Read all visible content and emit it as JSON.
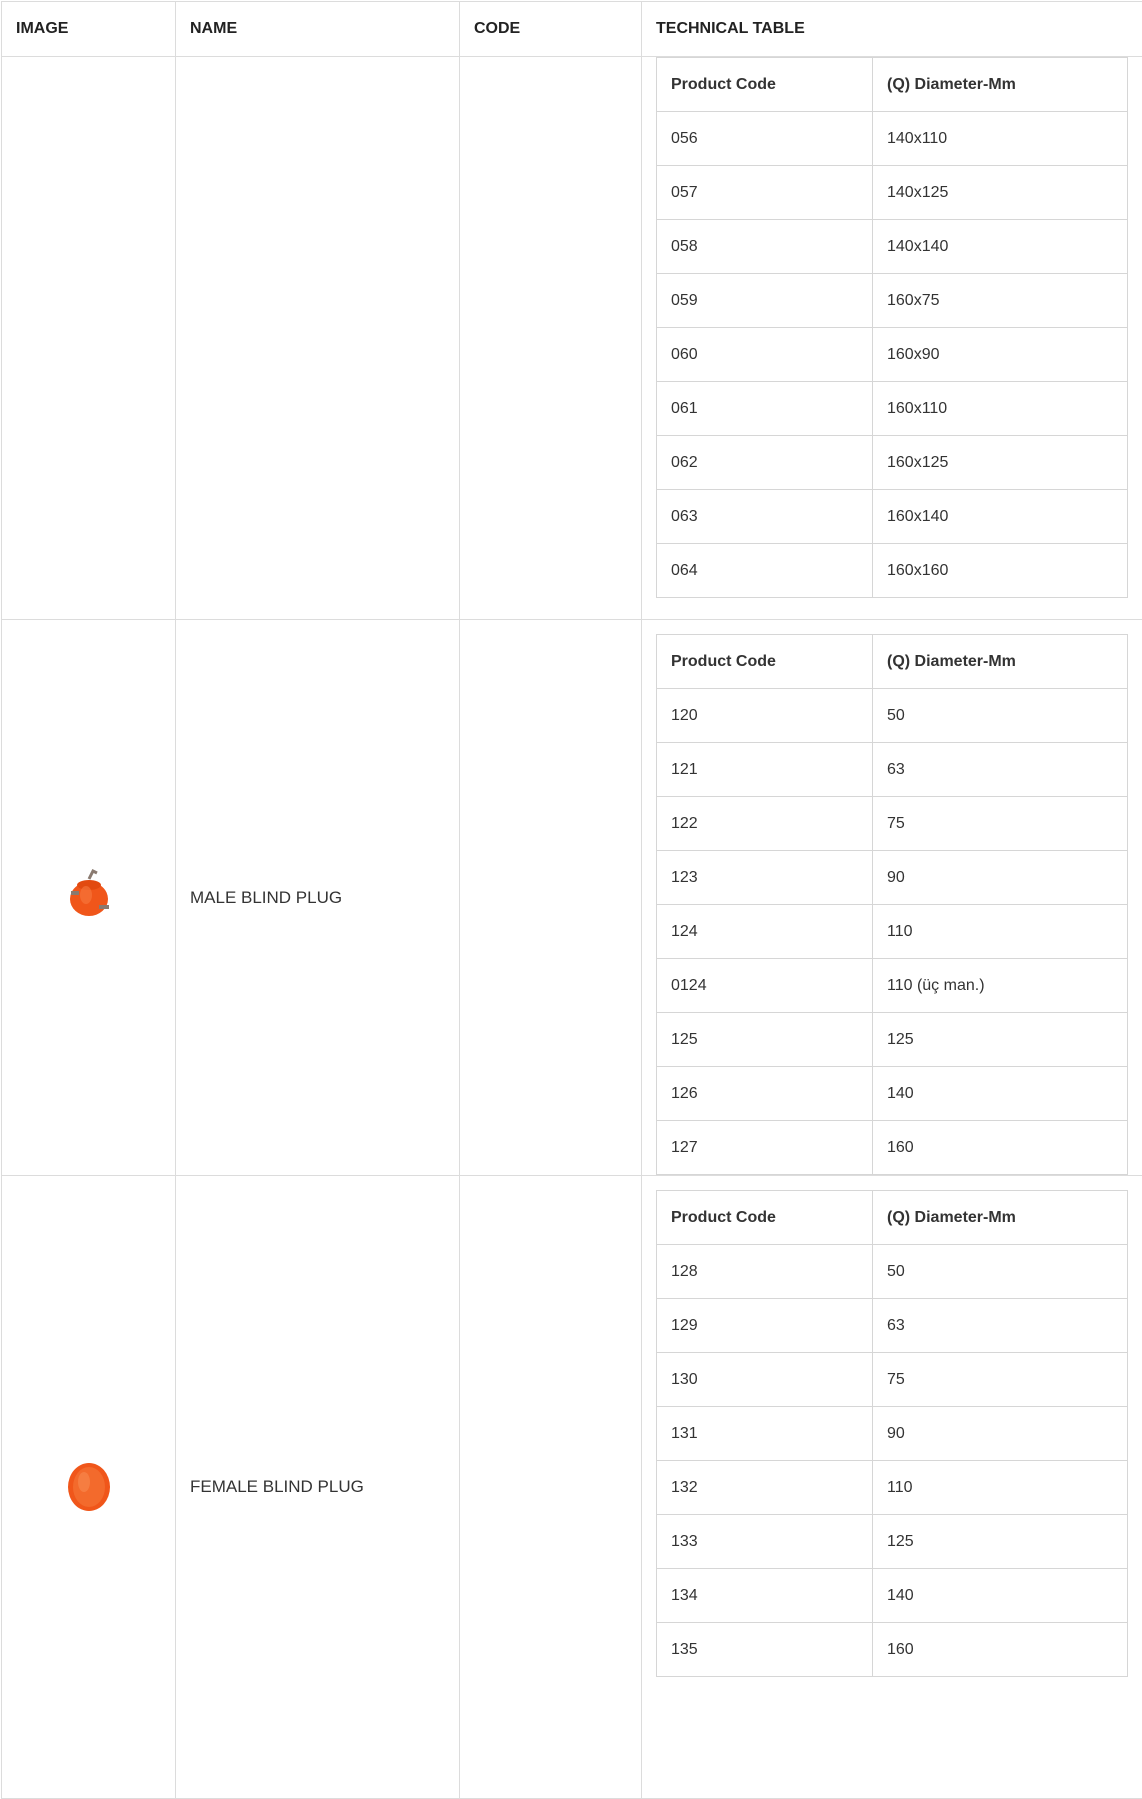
{
  "headers": {
    "image": "IMAGE",
    "name": "NAME",
    "code": "CODE",
    "technical": "TECHNICAL TABLE"
  },
  "inner_headers": {
    "product_code": "Product Code",
    "diameter": "(Q) Diameter-Mm"
  },
  "products": [
    {
      "image": "",
      "name": "",
      "code": "",
      "rows": [
        {
          "code": "056",
          "diameter": "140x110"
        },
        {
          "code": "057",
          "diameter": "140x125"
        },
        {
          "code": "058",
          "diameter": "140x140"
        },
        {
          "code": "059",
          "diameter": "160x75"
        },
        {
          "code": "060",
          "diameter": "160x90"
        },
        {
          "code": "061",
          "diameter": "160x110"
        },
        {
          "code": "062",
          "diameter": "160x125"
        },
        {
          "code": "063",
          "diameter": "160x140"
        },
        {
          "code": "064",
          "diameter": "160x160"
        }
      ]
    },
    {
      "image": "male-blind-plug-image",
      "name": "MALE BLIND PLUG",
      "code": "",
      "rows": [
        {
          "code": "120",
          "diameter": "50"
        },
        {
          "code": "121",
          "diameter": "63"
        },
        {
          "code": "122",
          "diameter": "75"
        },
        {
          "code": "123",
          "diameter": "90"
        },
        {
          "code": "124",
          "diameter": "110"
        },
        {
          "code": "0124",
          "diameter": "110 (üç man.)"
        },
        {
          "code": "125",
          "diameter": "125"
        },
        {
          "code": "126",
          "diameter": "140"
        },
        {
          "code": "127",
          "diameter": "160"
        }
      ]
    },
    {
      "image": "female-blind-plug-image",
      "name": "FEMALE BLIND PLUG",
      "code": "",
      "rows": [
        {
          "code": "128",
          "diameter": "50"
        },
        {
          "code": "129",
          "diameter": "63"
        },
        {
          "code": "130",
          "diameter": "75"
        },
        {
          "code": "131",
          "diameter": "90"
        },
        {
          "code": "132",
          "diameter": "110"
        },
        {
          "code": "133",
          "diameter": "125"
        },
        {
          "code": "134",
          "diameter": "140"
        },
        {
          "code": "135",
          "diameter": "160"
        }
      ]
    }
  ],
  "colors": {
    "border": "#dcdcdc",
    "plug_orange": "#f05a14"
  }
}
